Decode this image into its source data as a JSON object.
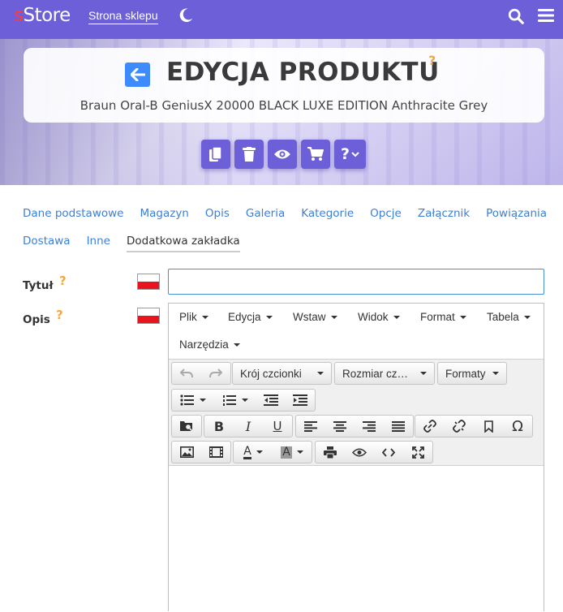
{
  "header": {
    "logo_prefix": "s",
    "logo_rest": "Store",
    "shop_link": "Strona sklepu",
    "icons": [
      "moon-icon",
      "search-icon",
      "menu-icon"
    ]
  },
  "hero": {
    "title": "EDYCJA PRODUKTU",
    "help": "?",
    "subtitle": "Braun Oral-B GeniusX 20000 BLACK LUXE EDITION Anthracite Grey",
    "actions": [
      "copy-icon",
      "trash-icon",
      "eye-icon",
      "cart-icon",
      "help-dropdown-icon"
    ],
    "action_help_label": "?"
  },
  "tabs": {
    "row1": [
      "Dane podstawowe",
      "Magazyn",
      "Opis",
      "Galeria",
      "Kategorie",
      "Opcje",
      "Załącznik",
      "Powiązania"
    ],
    "row2": [
      "Dostawa",
      "Inne",
      "Dodatkowa zakładka"
    ],
    "active": "Dodatkowa zakładka"
  },
  "form": {
    "title_label": "Tytuł",
    "title_help": "?",
    "title_value": "",
    "desc_label": "Opis",
    "desc_help": "?"
  },
  "editor": {
    "menu": [
      "Plik",
      "Edycja",
      "Wstaw",
      "Widok",
      "Format",
      "Tabela",
      "Narzędzia"
    ],
    "font_family": "Krój czcionki",
    "font_size": "Rozmiar cz…",
    "formats": "Formaty",
    "bold": "B",
    "italic": "I",
    "underline": "U",
    "omega": "Ω",
    "text_color": "A",
    "bg_color": "A"
  },
  "colors": {
    "nav": "#6c5fd8",
    "link": "#3d7fd6",
    "back_button": "#3d8bfd",
    "help": "#f2a93b"
  }
}
